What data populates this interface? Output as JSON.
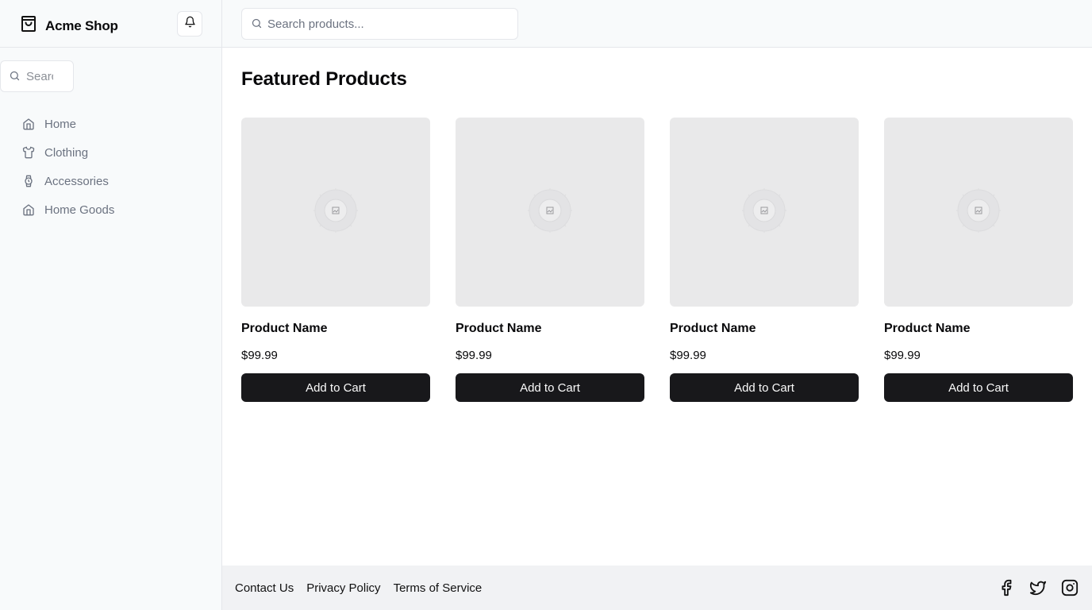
{
  "brand": {
    "name": "Acme Shop",
    "logo_icon": "shopping-bag-icon"
  },
  "header": {
    "notification_icon": "bell-icon"
  },
  "sidebar": {
    "search": {
      "placeholder": "Search"
    },
    "items": [
      {
        "label": "Home",
        "icon": "home-icon"
      },
      {
        "label": "Clothing",
        "icon": "shirt-icon"
      },
      {
        "label": "Accessories",
        "icon": "watch-icon"
      },
      {
        "label": "Home Goods",
        "icon": "home-icon"
      }
    ]
  },
  "topbar": {
    "search": {
      "placeholder": "Search products..."
    }
  },
  "main": {
    "title": "Featured Products",
    "products": [
      {
        "name": "Product Name",
        "price": "$99.99",
        "button": "Add to Cart"
      },
      {
        "name": "Product Name",
        "price": "$99.99",
        "button": "Add to Cart"
      },
      {
        "name": "Product Name",
        "price": "$99.99",
        "button": "Add to Cart"
      },
      {
        "name": "Product Name",
        "price": "$99.99",
        "button": "Add to Cart"
      }
    ]
  },
  "footer": {
    "links": [
      "Contact Us",
      "Privacy Policy",
      "Terms of Service"
    ],
    "social": [
      "facebook-icon",
      "twitter-icon",
      "instagram-icon"
    ]
  },
  "colors": {
    "button_bg": "#18181b",
    "sidebar_bg": "#f8fafb",
    "footer_bg": "#f1f2f4",
    "placeholder_bg": "#e9e9ea",
    "muted_text": "#6b7280"
  }
}
